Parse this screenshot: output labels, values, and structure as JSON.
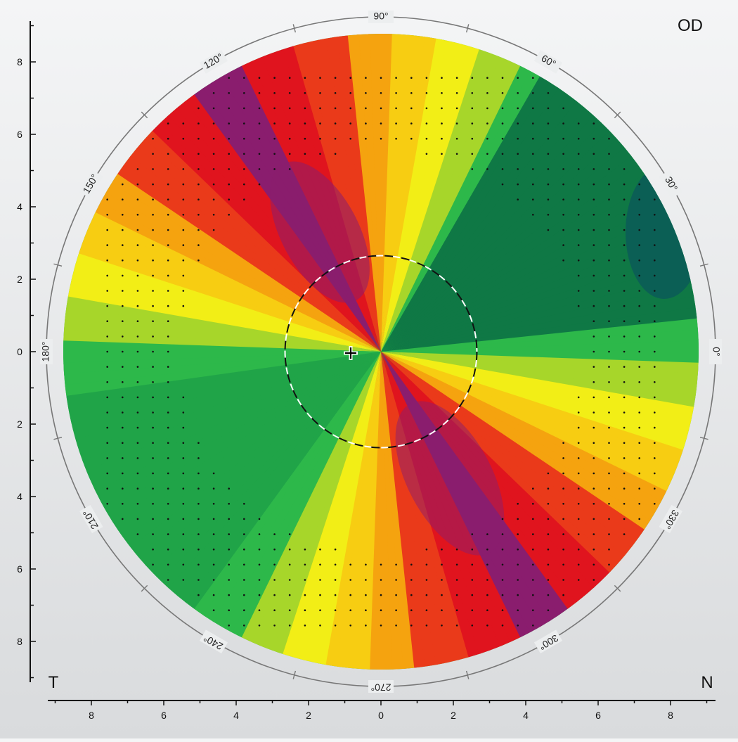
{
  "eye_label": "OD",
  "side_left_label": "T",
  "side_right_label": "N",
  "angle_labels": [
    {
      "text": "90°",
      "deg": 90
    },
    {
      "text": "60°",
      "deg": 60
    },
    {
      "text": "30°",
      "deg": 30
    },
    {
      "text": "0°",
      "deg": 0
    },
    {
      "text": "330°",
      "deg": 330
    },
    {
      "text": "300°",
      "deg": 300
    },
    {
      "text": "270°",
      "deg": 270
    },
    {
      "text": "240°",
      "deg": 240
    },
    {
      "text": "210°",
      "deg": 210
    },
    {
      "text": "180°",
      "deg": 180
    },
    {
      "text": "150°",
      "deg": 150
    },
    {
      "text": "120°",
      "deg": 120
    }
  ],
  "x_axis_ticks": [
    {
      "text": "8",
      "value": -8
    },
    {
      "text": "6",
      "value": -6
    },
    {
      "text": "4",
      "value": -4
    },
    {
      "text": "2",
      "value": -2
    },
    {
      "text": "0",
      "value": 0
    },
    {
      "text": "2",
      "value": 2
    },
    {
      "text": "4",
      "value": 4
    },
    {
      "text": "6",
      "value": 6
    },
    {
      "text": "8",
      "value": 8
    }
  ],
  "y_axis_ticks": [
    {
      "text": "8",
      "value": 8
    },
    {
      "text": "6",
      "value": 6
    },
    {
      "text": "4",
      "value": 4
    },
    {
      "text": "2",
      "value": 2
    },
    {
      "text": "0",
      "value": 0
    },
    {
      "text": "2",
      "value": -2
    },
    {
      "text": "4",
      "value": -4
    },
    {
      "text": "6",
      "value": -6
    },
    {
      "text": "8",
      "value": -8
    }
  ],
  "map": {
    "bowtie_axis_deg": 120,
    "pupil_radius": 2.65,
    "map_radius": 8.7,
    "colors": {
      "peak": "#8a1d6e",
      "high": "#e0141e",
      "mid": "#f5a30f",
      "yellow": "#f2ee16",
      "green": "#2db84a",
      "dark_green": "#0f7845",
      "teal": "#0a5a58"
    }
  }
}
